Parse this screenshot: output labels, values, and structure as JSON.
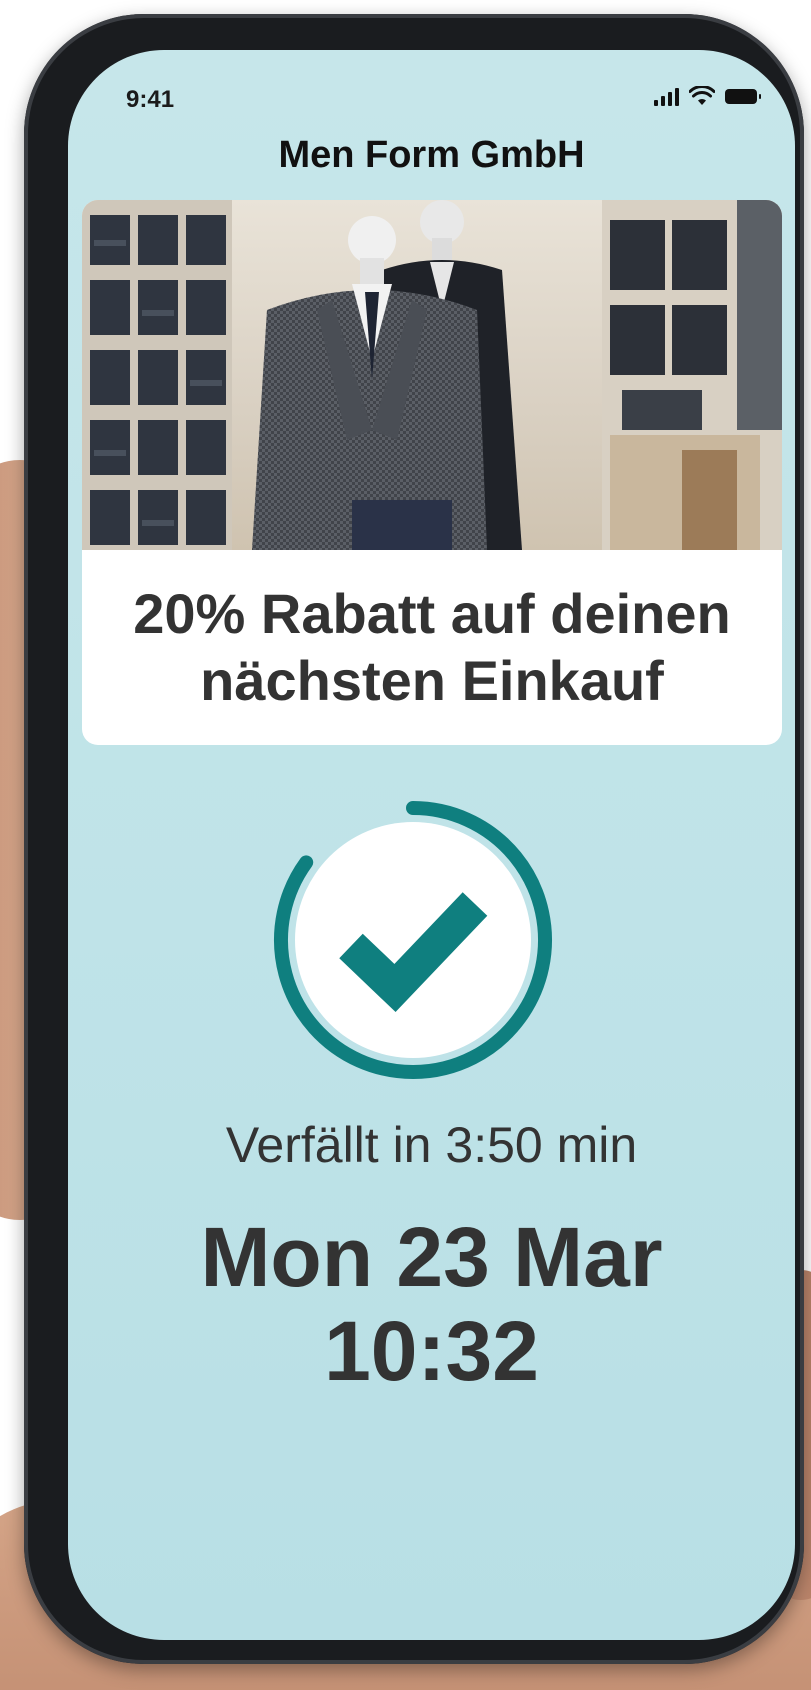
{
  "status_bar": {
    "time": "9:41",
    "icons": [
      "cellular-signal-icon",
      "wifi-icon",
      "battery-icon"
    ]
  },
  "app": {
    "title": "Men Form GmbH"
  },
  "promo": {
    "image_subject": "suit-mannequins-photo",
    "headline": "20% Rabatt auf deinen nächsten Einkauf"
  },
  "validation": {
    "icon": "checkmark-icon",
    "status": "valid",
    "remaining_fraction": 0.85,
    "countdown_text": "Verfällt in 3:50 min",
    "date": "Mon 23 Mar",
    "time": "10:32"
  },
  "colors": {
    "accent": "#0f7f7f",
    "screen_background": "#c6e6ea",
    "text": "#333333"
  }
}
